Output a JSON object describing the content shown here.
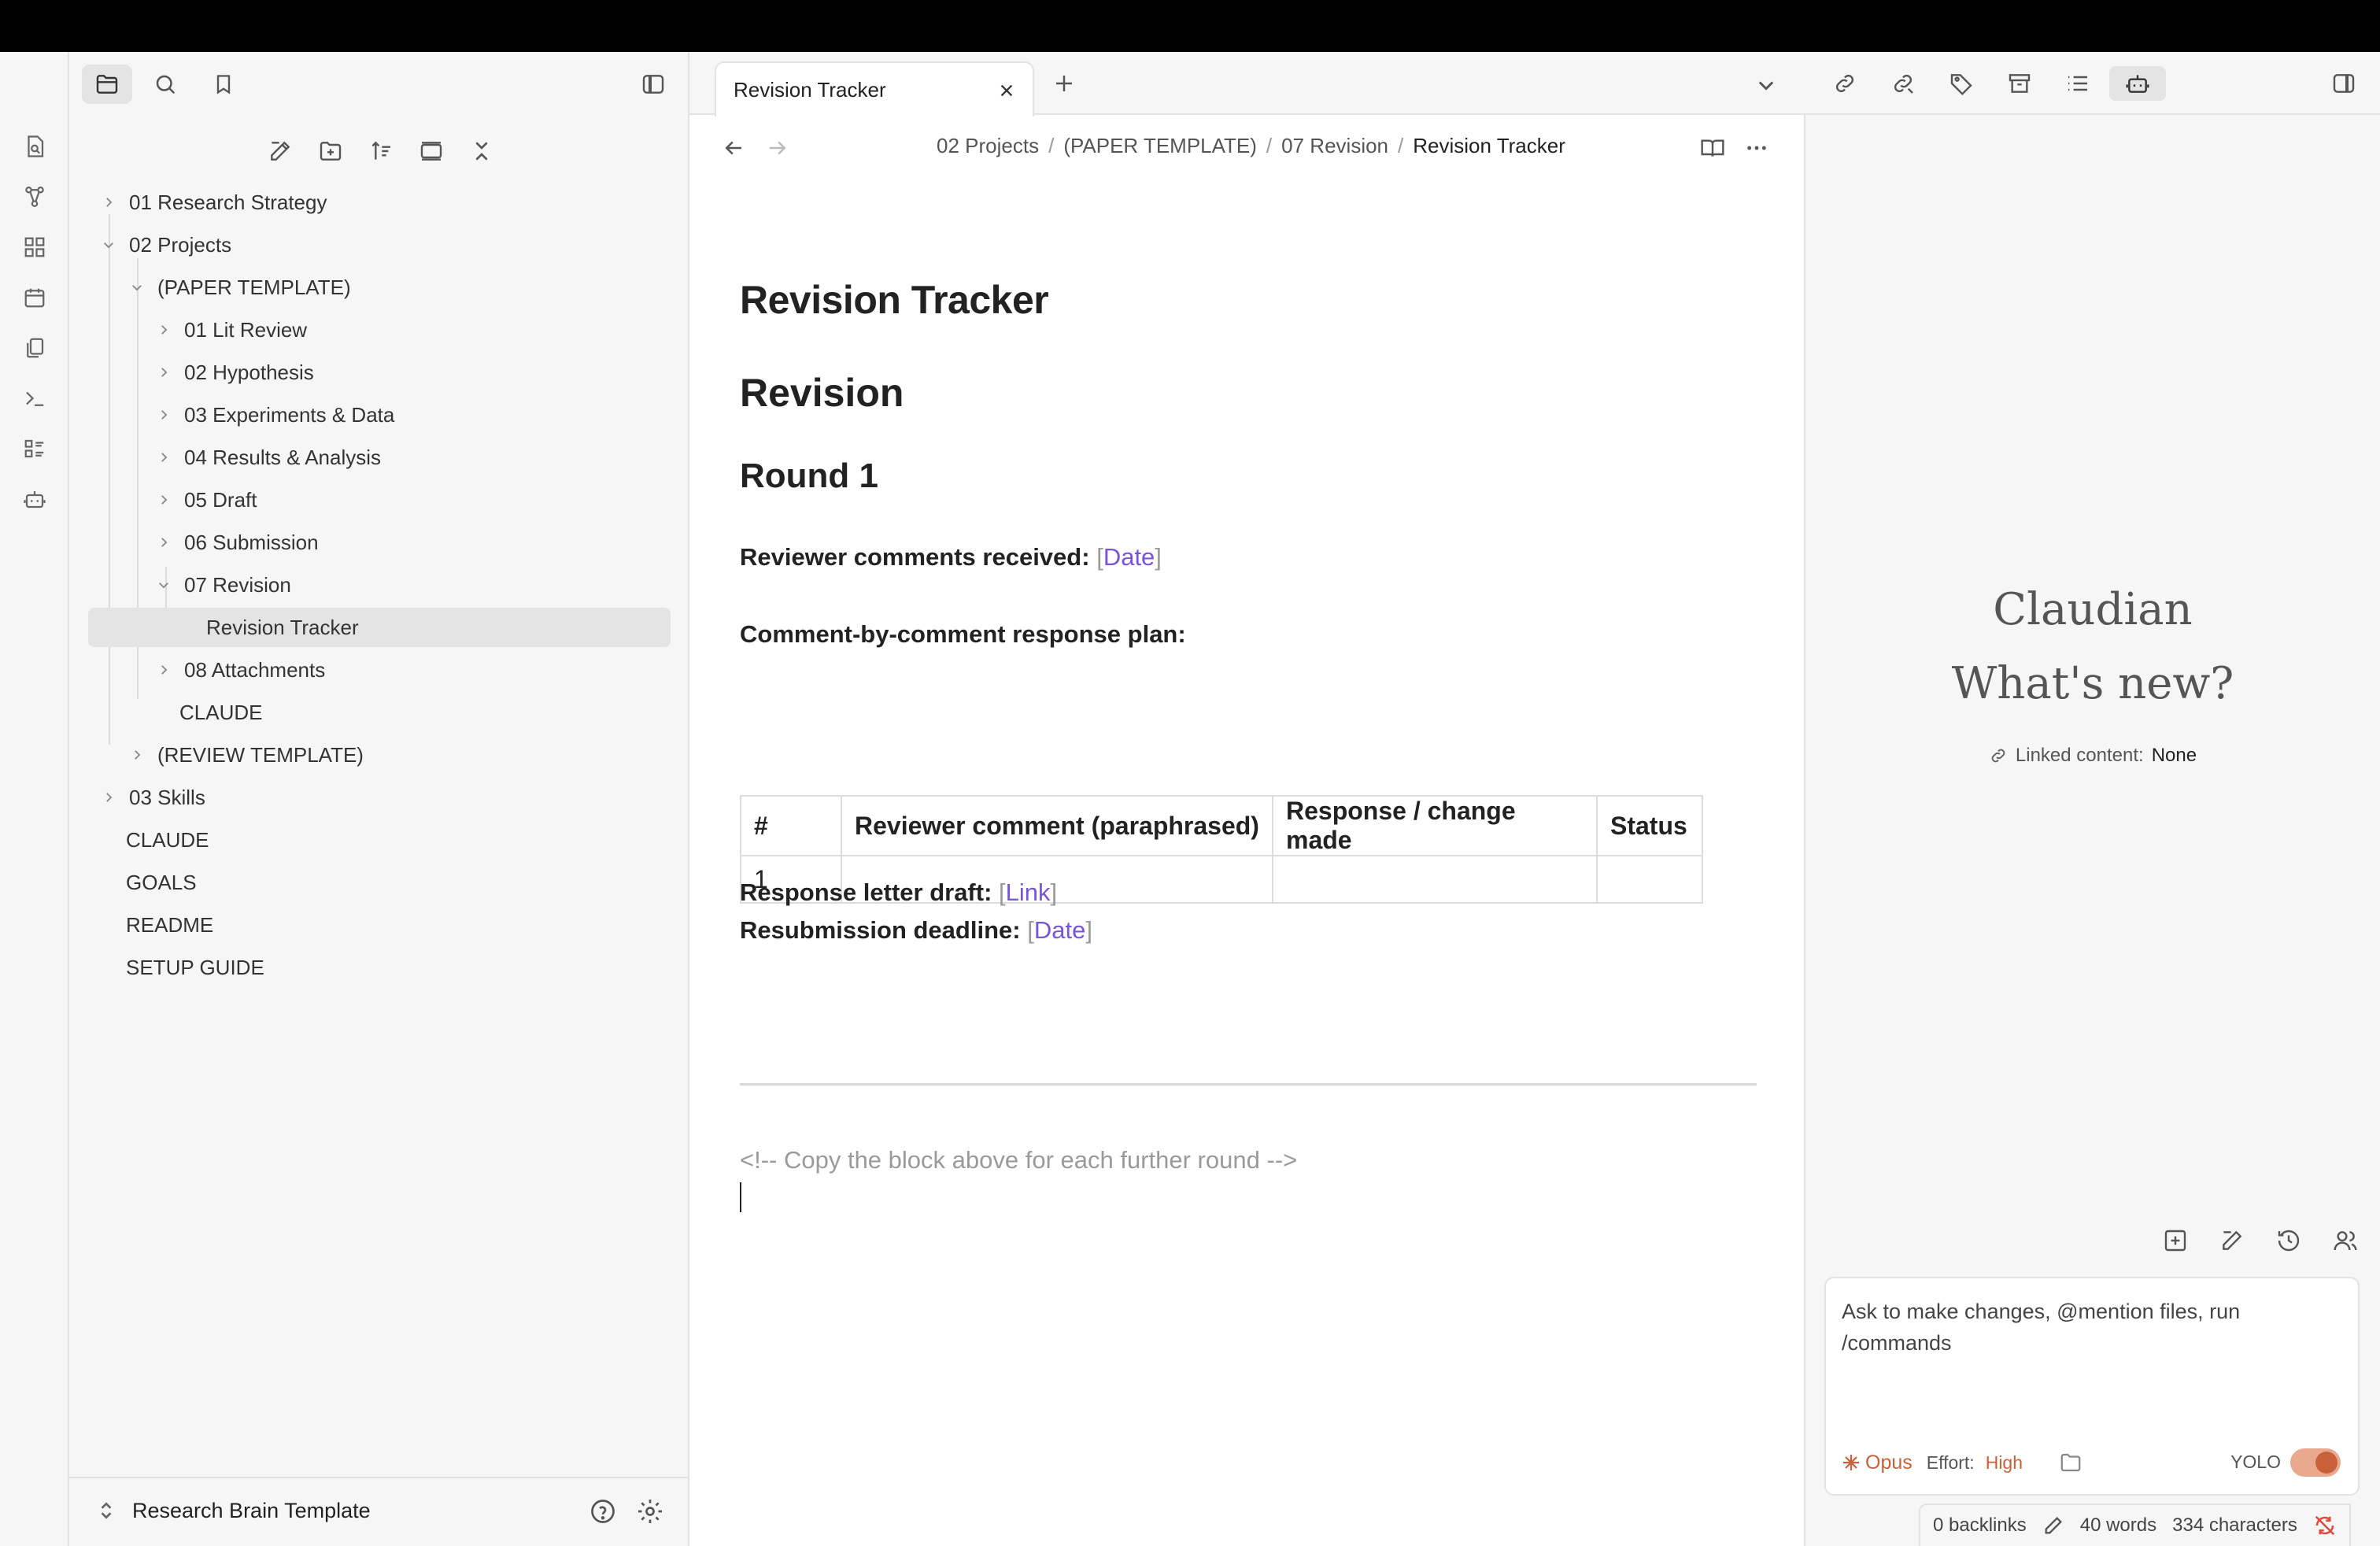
{
  "sidebar": {
    "tree": [
      {
        "label": "01 Research Strategy"
      },
      {
        "label": "02 Projects"
      },
      {
        "label": "(PAPER TEMPLATE)"
      },
      {
        "label": "01 Lit Review"
      },
      {
        "label": "02 Hypothesis"
      },
      {
        "label": "03 Experiments & Data"
      },
      {
        "label": "04 Results & Analysis"
      },
      {
        "label": "05 Draft"
      },
      {
        "label": "06 Submission"
      },
      {
        "label": "07 Revision"
      },
      {
        "label": "Revision Tracker"
      },
      {
        "label": "08 Attachments"
      },
      {
        "label": "CLAUDE"
      },
      {
        "label": "(REVIEW TEMPLATE)"
      },
      {
        "label": "03 Skills"
      },
      {
        "label": "CLAUDE"
      },
      {
        "label": "GOALS"
      },
      {
        "label": "README"
      },
      {
        "label": "SETUP GUIDE"
      }
    ],
    "vault_name": "Research Brain Template"
  },
  "tabs": [
    {
      "label": "Revision Tracker"
    }
  ],
  "breadcrumb": {
    "items": [
      "02 Projects",
      "(PAPER TEMPLATE)",
      "07 Revision"
    ],
    "current": "Revision Tracker",
    "sep": "/"
  },
  "note": {
    "title": "Revision Tracker",
    "h2": "Revision",
    "h3": "Round 1",
    "received_label": "Reviewer comments received:",
    "received_value": "Date",
    "plan_label": "Comment-by-comment response plan:",
    "table": {
      "headers": [
        "#",
        "Reviewer comment (paraphrased)",
        "Response / change made",
        "Status"
      ],
      "rows": [
        [
          "1",
          "",
          "",
          ""
        ]
      ]
    },
    "letter_label": "Response letter draft:",
    "letter_value": "Link",
    "deadline_label": "Resubmission deadline:",
    "deadline_value": "Date",
    "comment": "<!-- Copy the block above for each further round -->",
    "bracket_open": "[",
    "bracket_close": "]"
  },
  "claudian": {
    "title": "Claudian",
    "subtitle": "What's new?",
    "linked_label": "Linked content:",
    "linked_value": "None",
    "placeholder": "Ask to make changes, @mention files, run /commands",
    "model": "Opus",
    "effort_label": "Effort:",
    "effort_value": "High",
    "yolo_label": "YOLO"
  },
  "statusbar": {
    "backlinks": "0 backlinks",
    "words": "40 words",
    "characters": "334 characters"
  },
  "colors": {
    "accent_link": "#7a54d8",
    "claude_orange": "#c8613a"
  }
}
